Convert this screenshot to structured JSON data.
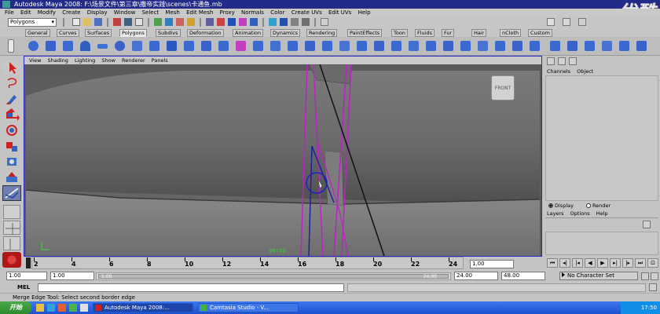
{
  "window": {
    "title": "Autodesk Maya 2008: F:\\场景文件\\第三章\\撒帝实践\\scenes\\卡通鱼.mb",
    "watermark": "优酷"
  },
  "menubar": [
    "File",
    "Edit",
    "Modify",
    "Create",
    "Display",
    "Window",
    "Select",
    "Mesh",
    "Edit Mesh",
    "Proxy",
    "Normals",
    "Color",
    "Create UVs",
    "Edit UVs",
    "Help"
  ],
  "statusline": {
    "mode": "Polygons"
  },
  "shelf_tabs": [
    "General",
    "Curves",
    "Surfaces",
    "Polygons",
    "Subdivs",
    "Deformation",
    "Animation",
    "Dynamics",
    "Rendering",
    "PaintEffects",
    "Toon",
    "Fluids",
    "Fur",
    "Hair",
    "nCloth",
    "Custom"
  ],
  "active_shelf_tab": "Polygons",
  "viewport": {
    "menu": [
      "View",
      "Shading",
      "Lighting",
      "Show",
      "Renderer",
      "Panels"
    ],
    "camera_label": "persp",
    "view_cube_label": "FRONT"
  },
  "channel_box": {
    "menu": [
      "Channels",
      "Object"
    ],
    "display_radio": "Display",
    "render_radio": "Render",
    "layers_menu": [
      "Layers",
      "Options",
      "Help"
    ]
  },
  "timeline": {
    "ticks": [
      "2",
      "4",
      "6",
      "8",
      "10",
      "12",
      "14",
      "16",
      "18",
      "20",
      "22",
      "24"
    ],
    "current_frame": "1.00"
  },
  "range_slider": {
    "start_time": "1.00",
    "playback_start": "1.00",
    "range_start_label": "1.00",
    "range_end_label": "24.00",
    "playback_end": "24.00",
    "end_time": "48.00",
    "character_set": "No Character Set"
  },
  "command_line": {
    "label": "MEL"
  },
  "help_line": "Merge Edge Tool: Select second border edge",
  "taskbar": {
    "start": "开始",
    "tasks": [
      "Autodesk Maya 2008:...",
      "Camtasia Studio - V..."
    ],
    "clock": "17:50"
  },
  "colors": {
    "title_bar": "#222b88",
    "viewport_bg": "#636363",
    "selection_magenta": "#c020c8",
    "panel_border": "#2a2ac8",
    "taskbar": "#1c50d0"
  }
}
